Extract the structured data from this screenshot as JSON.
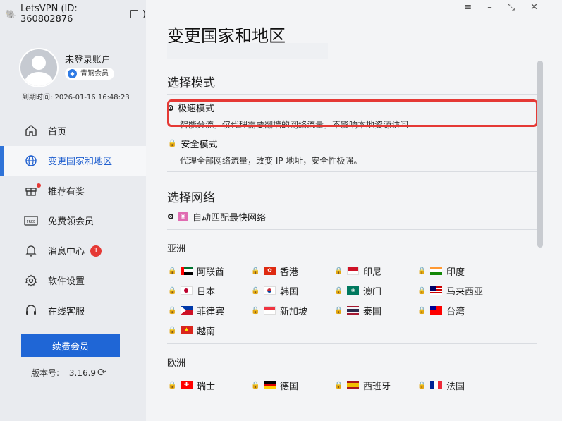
{
  "app": {
    "title": "LetsVPN (ID: 360802876",
    "title_suffix": ")"
  },
  "user": {
    "name": "未登录账户",
    "membership": "青铜会员",
    "expiry": "到期时间: 2026-01-16 16:48:23"
  },
  "nav": {
    "items": [
      {
        "label": "首页",
        "icon": "home-icon"
      },
      {
        "label": "变更国家和地区",
        "icon": "globe-icon",
        "active": true
      },
      {
        "label": "推荐有奖",
        "icon": "gift-icon",
        "dot": true
      },
      {
        "label": "免费领会员",
        "icon": "free-icon"
      },
      {
        "label": "消息中心",
        "icon": "bell-icon",
        "count": "1"
      },
      {
        "label": "软件设置",
        "icon": "gear-icon"
      },
      {
        "label": "在线客服",
        "icon": "headset-icon"
      }
    ]
  },
  "renew": {
    "label": "续费会员"
  },
  "version": {
    "label": "版本号:",
    "value": "3.16.9"
  },
  "window": {
    "menu": "≡",
    "minimize": "–",
    "shrink": "⤡",
    "close": "✕"
  },
  "main": {
    "title": "变更国家和地区",
    "mode_section": "选择模式",
    "modes": [
      {
        "name": "极速模式",
        "desc": "智能分流，仅代理需要翻墙的网络流量，不影响本地资源访问",
        "selected": true
      },
      {
        "name": "安全模式",
        "desc": "代理全部网络流量，改变 IP 地址，安全性极强。",
        "selected": false
      }
    ],
    "network_section": "选择网络",
    "auto_network": "自动匹配最快网络",
    "regions": [
      {
        "name": "亚洲",
        "countries": [
          "阿联酋",
          "香港",
          "印尼",
          "印度",
          "日本",
          "韩国",
          "澳门",
          "马来西亚",
          "菲律宾",
          "新加坡",
          "泰国",
          "台湾",
          "越南"
        ]
      },
      {
        "name": "欧洲",
        "countries": [
          "瑞士",
          "德国",
          "西班牙",
          "法国"
        ]
      }
    ]
  },
  "colors": {
    "accent": "#1f66d6",
    "highlight": "#e53935",
    "badge": "#e53935"
  }
}
